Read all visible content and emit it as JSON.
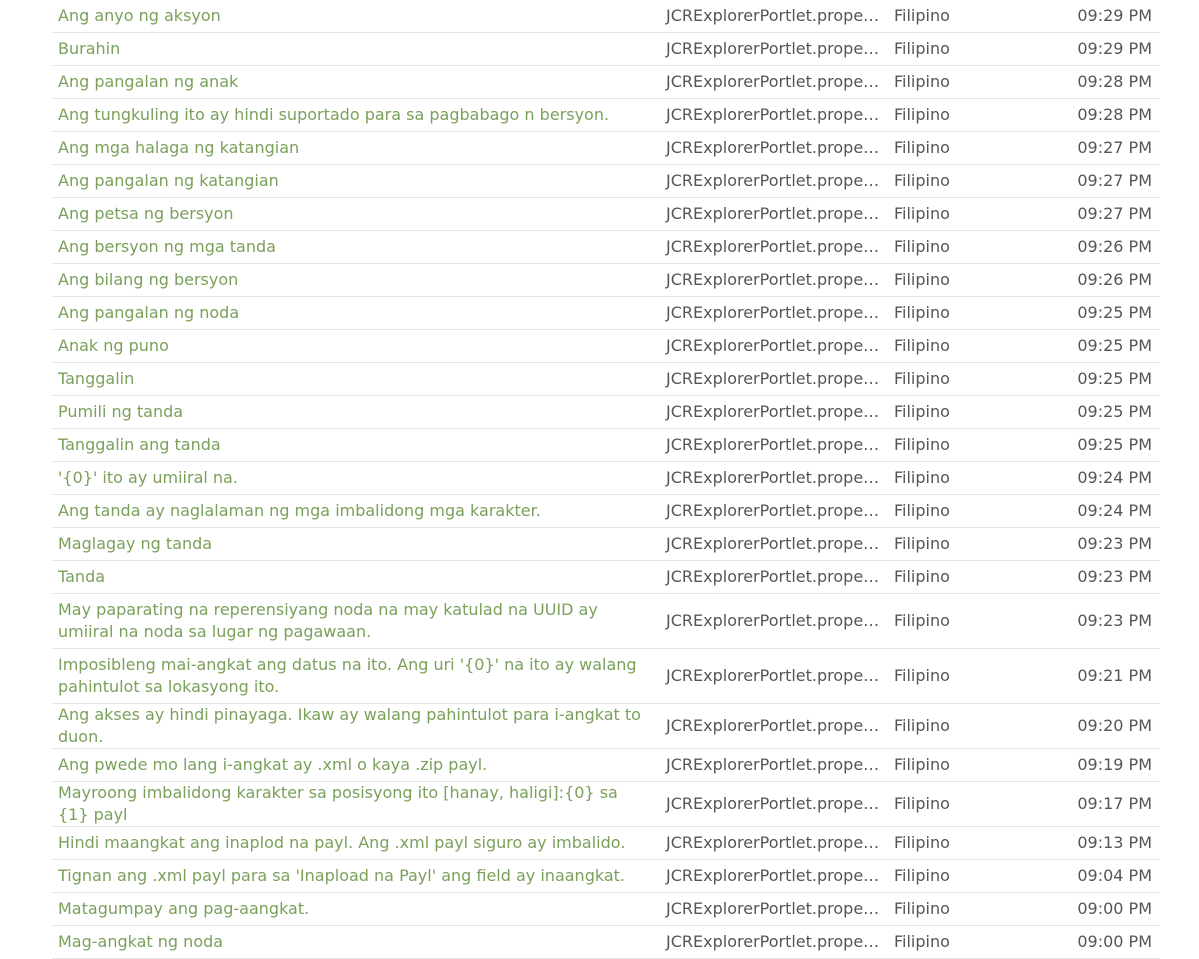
{
  "rows": [
    {
      "text": "Ang anyo ng aksyon",
      "file": "JCRExplorerPortlet.proper…",
      "language": "Filipino",
      "time": "09:29 PM"
    },
    {
      "text": "Burahin",
      "file": "JCRExplorerPortlet.proper…",
      "language": "Filipino",
      "time": "09:29 PM"
    },
    {
      "text": "Ang pangalan ng anak",
      "file": "JCRExplorerPortlet.proper…",
      "language": "Filipino",
      "time": "09:28 PM"
    },
    {
      "text": "Ang tungkuling ito ay hindi suportado para sa pagbabago n bersyon.",
      "file": "JCRExplorerPortlet.proper…",
      "language": "Filipino",
      "time": "09:28 PM"
    },
    {
      "text": "Ang mga halaga ng katangian",
      "file": "JCRExplorerPortlet.proper…",
      "language": "Filipino",
      "time": "09:27 PM"
    },
    {
      "text": "Ang pangalan ng katangian",
      "file": "JCRExplorerPortlet.proper…",
      "language": "Filipino",
      "time": "09:27 PM"
    },
    {
      "text": "Ang petsa ng bersyon",
      "file": "JCRExplorerPortlet.proper…",
      "language": "Filipino",
      "time": "09:27 PM"
    },
    {
      "text": "Ang bersyon ng mga tanda",
      "file": "JCRExplorerPortlet.proper…",
      "language": "Filipino",
      "time": "09:26 PM"
    },
    {
      "text": "Ang bilang ng bersyon",
      "file": "JCRExplorerPortlet.proper…",
      "language": "Filipino",
      "time": "09:26 PM"
    },
    {
      "text": "Ang pangalan ng noda",
      "file": "JCRExplorerPortlet.proper…",
      "language": "Filipino",
      "time": "09:25 PM"
    },
    {
      "text": "Anak ng puno",
      "file": "JCRExplorerPortlet.proper…",
      "language": "Filipino",
      "time": "09:25 PM"
    },
    {
      "text": "Tanggalin",
      "file": "JCRExplorerPortlet.proper…",
      "language": "Filipino",
      "time": "09:25 PM"
    },
    {
      "text": "Pumili ng tanda",
      "file": "JCRExplorerPortlet.proper…",
      "language": "Filipino",
      "time": "09:25 PM"
    },
    {
      "text": "Tanggalin ang tanda",
      "file": "JCRExplorerPortlet.proper…",
      "language": "Filipino",
      "time": "09:25 PM"
    },
    {
      "text": "'{0}' ito ay umiiral na.",
      "file": "JCRExplorerPortlet.proper…",
      "language": "Filipino",
      "time": "09:24 PM"
    },
    {
      "text": "Ang tanda ay naglalaman ng mga imbalidong mga karakter.",
      "file": "JCRExplorerPortlet.proper…",
      "language": "Filipino",
      "time": "09:24 PM"
    },
    {
      "text": "Maglagay ng tanda",
      "file": "JCRExplorerPortlet.proper…",
      "language": "Filipino",
      "time": "09:23 PM"
    },
    {
      "text": "Tanda",
      "file": "JCRExplorerPortlet.proper…",
      "language": "Filipino",
      "time": "09:23 PM"
    },
    {
      "text": "May paparating na reperensiyang noda na may katulad na UUID ay umiiral na noda sa lugar ng pagawaan.",
      "file": "JCRExplorerPortlet.proper…",
      "language": "Filipino",
      "time": "09:23 PM",
      "double": true
    },
    {
      "text": "Imposibleng mai-angkat ang datus na ito. Ang uri '{0}' na ito ay walang pahintulot sa lokasyong ito.",
      "file": "JCRExplorerPortlet.proper…",
      "language": "Filipino",
      "time": "09:21 PM",
      "double": true
    },
    {
      "text": "Ang akses ay hindi pinayaga. Ikaw ay walang pahintulot para i-angkat to duon.",
      "file": "JCRExplorerPortlet.proper…",
      "language": "Filipino",
      "time": "09:20 PM"
    },
    {
      "text": "Ang pwede mo lang i-angkat ay .xml o kaya .zip payl.",
      "file": "JCRExplorerPortlet.proper…",
      "language": "Filipino",
      "time": "09:19 PM"
    },
    {
      "text": "Mayroong imbalidong karakter sa posisyong ito [hanay, haligi]:{0} sa {1} payl",
      "file": "JCRExplorerPortlet.proper…",
      "language": "Filipino",
      "time": "09:17 PM"
    },
    {
      "text": "Hindi maangkat ang inaplod na payl. Ang .xml payl siguro ay imbalido.",
      "file": "JCRExplorerPortlet.proper…",
      "language": "Filipino",
      "time": "09:13 PM"
    },
    {
      "text": "Tignan ang .xml payl para sa 'Inapload na Payl' ang field ay inaangkat.",
      "file": "JCRExplorerPortlet.proper…",
      "language": "Filipino",
      "time": "09:04 PM"
    },
    {
      "text": "Matagumpay ang pag-aangkat.",
      "file": "JCRExplorerPortlet.proper…",
      "language": "Filipino",
      "time": "09:00 PM"
    },
    {
      "text": "Mag-angkat ng noda",
      "file": "JCRExplorerPortlet.proper…",
      "language": "Filipino",
      "time": "09:00 PM"
    }
  ],
  "colors": {
    "link": "#7aa05a",
    "text": "#555555",
    "row_border": "#e4e4e4"
  }
}
